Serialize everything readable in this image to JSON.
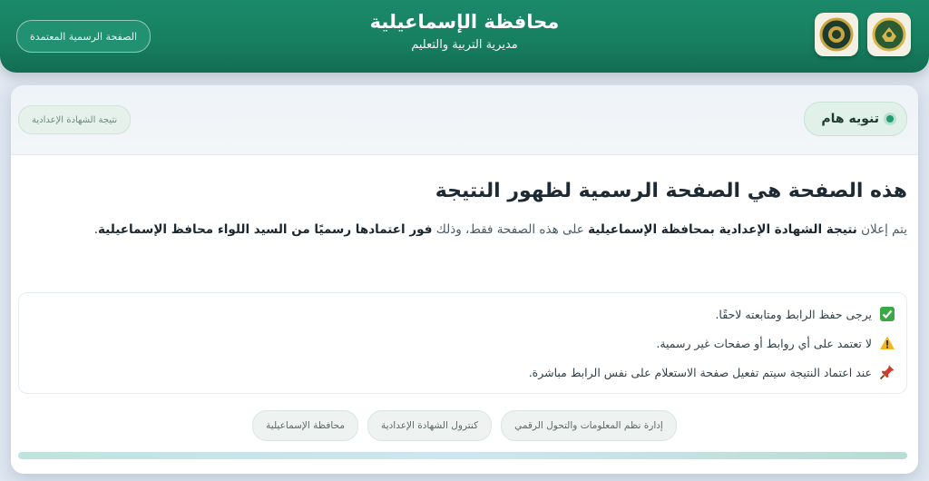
{
  "header": {
    "title": "محافظة الإسماعيلية",
    "subtitle": "مديرية التربية والتعليم",
    "official_button": "الصفحة الرسمية المعتمدة",
    "logos": [
      "governorate-emblem",
      "directorate-emblem"
    ]
  },
  "card": {
    "notice_label": "تنويه هام",
    "result_badge": "نتيجة الشهادة الإعدادية",
    "main_title": "هذه الصفحة هي الصفحة الرسمية لظهور النتيجة",
    "paragraph": {
      "p1": "يتم إعلان ",
      "p2": "نتيجة الشهادة الإعدادية بمحافظة الإسماعيلية",
      "p3": " على هذه الصفحة فقط، وذلك ",
      "p4": "فور اعتمادها رسميًا من السيد اللواء محافظ الإسماعيلية",
      "p5": "."
    },
    "notes": [
      {
        "icon": "check-icon",
        "text": "يرجى حفظ الرابط ومتابعته لاحقًا."
      },
      {
        "icon": "warning-icon",
        "text": "لا تعتمد على أي روابط أو صفحات غير رسمية."
      },
      {
        "icon": "pin-icon",
        "text": "عند اعتماد النتيجة سيتم تفعيل صفحة الاستعلام على نفس الرابط مباشرة."
      }
    ],
    "footer_pills": [
      "إدارة نظم المعلومات والتحول الرقمي",
      "كنترول الشهادة الإعدادية",
      "محافظة الإسماعيلية"
    ]
  },
  "colors": {
    "header_green": "#17805f",
    "accent_green": "#1f9d72",
    "background": "#dfe7f1"
  }
}
